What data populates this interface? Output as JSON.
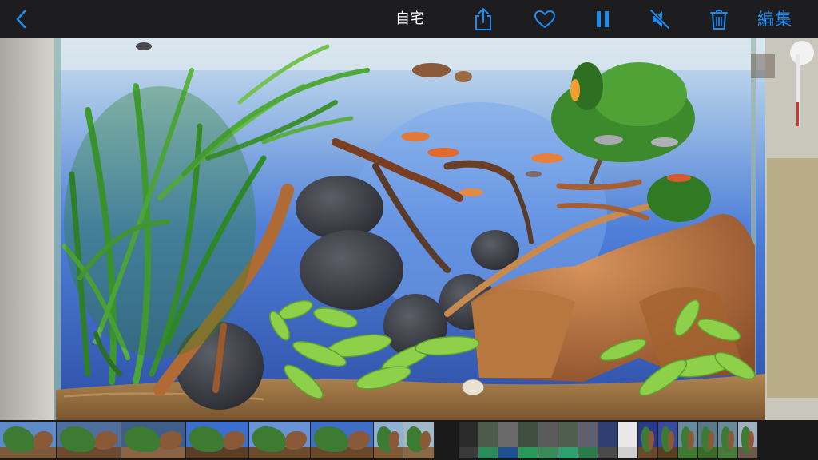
{
  "toolbar": {
    "title": "自宅",
    "edit_label": "編集",
    "accent_color": "#1e8bf1",
    "icons": [
      "chevron-left-icon",
      "share-icon",
      "heart-icon",
      "pause-icon",
      "speaker-muted-icon",
      "trash-icon"
    ]
  },
  "photo": {
    "subject": "aquarium"
  },
  "thumbnails": [
    {
      "kind": "aquarium",
      "water": "#5f8ac8",
      "sand": "#7a5a3a",
      "w": 70
    },
    {
      "kind": "aquarium",
      "water": "#4f6f9f",
      "sand": "#6b4a2f",
      "w": 80
    },
    {
      "kind": "aquarium",
      "water": "#3f5f8a",
      "sand": "#8a6444",
      "w": 80
    },
    {
      "kind": "aquarium",
      "water": "#3a6fcf",
      "sand": "#5c3e26",
      "w": 78
    },
    {
      "kind": "aquarium",
      "water": "#6a93d6",
      "sand": "#6c4a2c",
      "w": 76
    },
    {
      "kind": "aquarium",
      "water": "#3e6ec8",
      "sand": "#6a4728",
      "w": 78
    },
    {
      "kind": "aquarium",
      "water": "#8fb0d0",
      "sand": "#7f5a35",
      "w": 36
    },
    {
      "kind": "aquarium",
      "water": "#a0b8c8",
      "sand": "#8a6a44",
      "w": 38
    },
    {
      "kind": "screen",
      "water": "#2a2a2a",
      "sand": "#3a3a3a",
      "w": 24
    },
    {
      "kind": "room",
      "water": "#4b5a4b",
      "sand": "#2b8b5b",
      "w": 24
    },
    {
      "kind": "room",
      "water": "#6a6a6a",
      "sand": "#1f4f8f",
      "w": 24
    },
    {
      "kind": "room",
      "water": "#3f4f3f",
      "sand": "#2a9a5a",
      "w": 24
    },
    {
      "kind": "room",
      "water": "#5a5a5a",
      "sand": "#3a8a5a",
      "w": 24
    },
    {
      "kind": "room",
      "water": "#4f5f4f",
      "sand": "#2f9f6f",
      "w": 24
    },
    {
      "kind": "room",
      "water": "#5f5f6f",
      "sand": "#2b7b4b",
      "w": 24
    },
    {
      "kind": "room",
      "water": "#2f3f6f",
      "sand": "#4a4a4a",
      "w": 24
    },
    {
      "kind": "document",
      "water": "#e8e8e8",
      "sand": "#d0d0d0",
      "w": 24
    },
    {
      "kind": "aquarium",
      "water": "#2a3a8a",
      "sand": "#6a4a2a",
      "w": 24
    },
    {
      "kind": "aquarium",
      "water": "#3a4aa0",
      "sand": "#5a3e24",
      "w": 24
    },
    {
      "kind": "aquarium",
      "water": "#6a8aa0",
      "sand": "#3f7a32",
      "w": 24
    },
    {
      "kind": "aquarium",
      "water": "#5a7a8a",
      "sand": "#3a6a2a",
      "w": 24
    },
    {
      "kind": "aquarium",
      "water": "#6a8a9a",
      "sand": "#4a7a3a",
      "w": 24
    },
    {
      "kind": "aquarium",
      "water": "#a0b0c0",
      "sand": "#6a5a4a",
      "w": 24
    }
  ]
}
